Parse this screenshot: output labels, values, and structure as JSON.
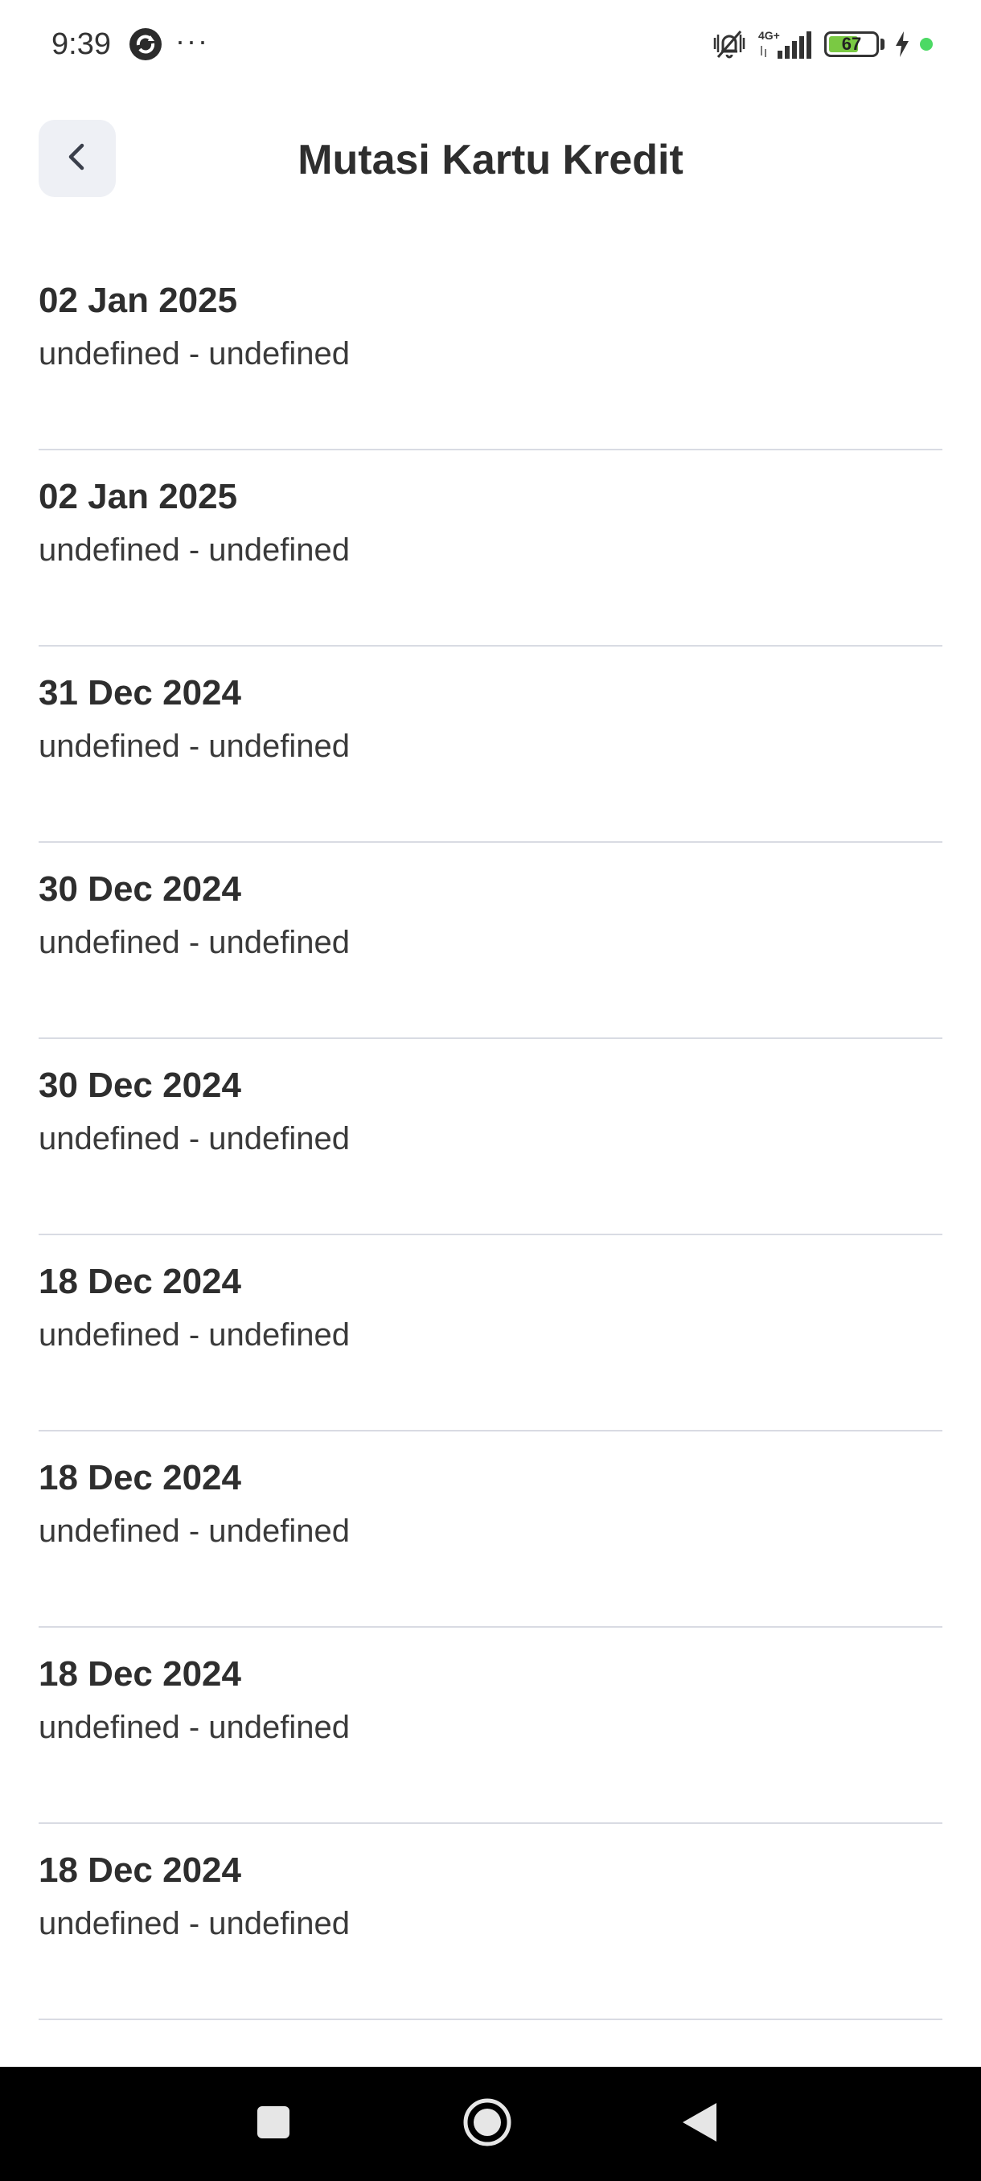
{
  "status_bar": {
    "time": "9:39",
    "more": "···",
    "network": "4G+",
    "battery": "67",
    "battery_level": 0.67
  },
  "header": {
    "title": "Mutasi Kartu Kredit",
    "back_icon": "chevron-left-icon"
  },
  "transactions": [
    {
      "date": "02 Jan 2025",
      "description": "undefined - undefined"
    },
    {
      "date": "02 Jan 2025",
      "description": "undefined - undefined"
    },
    {
      "date": "31 Dec 2024",
      "description": "undefined - undefined"
    },
    {
      "date": "30 Dec 2024",
      "description": "undefined - undefined"
    },
    {
      "date": "30 Dec 2024",
      "description": "undefined - undefined"
    },
    {
      "date": "18 Dec 2024",
      "description": "undefined - undefined"
    },
    {
      "date": "18 Dec 2024",
      "description": "undefined - undefined"
    },
    {
      "date": "18 Dec 2024",
      "description": "undefined - undefined"
    },
    {
      "date": "18 Dec 2024",
      "description": "undefined - undefined"
    }
  ],
  "nav_bar": {
    "buttons": [
      "recents-square-icon",
      "home-circle-icon",
      "back-triangle-icon"
    ]
  },
  "colors": {
    "accent_bg": "#eef0f5",
    "divider": "#d9dbe3",
    "battery": "#7ac943"
  }
}
